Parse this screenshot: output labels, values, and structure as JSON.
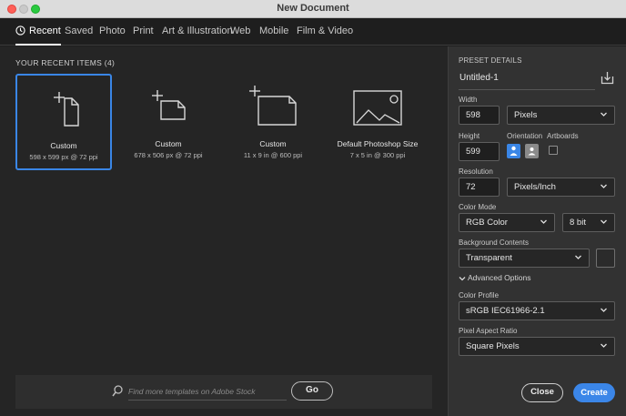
{
  "window": {
    "title": "New Document"
  },
  "tabs": [
    {
      "label": "Recent",
      "icon": "clock-icon"
    },
    {
      "label": "Saved"
    },
    {
      "label": "Photo"
    },
    {
      "label": "Print"
    },
    {
      "label": "Art & Illustration"
    },
    {
      "label": "Web"
    },
    {
      "label": "Mobile"
    },
    {
      "label": "Film & Video"
    }
  ],
  "recent": {
    "heading": "YOUR RECENT ITEMS  (4)",
    "items": [
      {
        "name": "Custom",
        "dims": "598 x 599 px @ 72 ppi",
        "icon": "custom-document-icon"
      },
      {
        "name": "Custom",
        "dims": "678 x 506 px @ 72 ppi",
        "icon": "custom-document-icon"
      },
      {
        "name": "Custom",
        "dims": "11 x 9 in @ 600 ppi",
        "icon": "custom-document-icon"
      },
      {
        "name": "Default Photoshop Size",
        "dims": "7 x 5 in @ 300 ppi",
        "icon": "image-icon"
      }
    ]
  },
  "search": {
    "placeholder": "Find more templates on Adobe Stock",
    "go_label": "Go"
  },
  "preset": {
    "heading": "PRESET DETAILS",
    "name": "Untitled-1",
    "width_label": "Width",
    "width_value": "598",
    "width_unit": "Pixels",
    "height_label": "Height",
    "height_value": "599",
    "orientation_label": "Orientation",
    "artboards_label": "Artboards",
    "resolution_label": "Resolution",
    "resolution_value": "72",
    "resolution_unit": "Pixels/Inch",
    "color_mode_label": "Color Mode",
    "color_mode_value": "RGB Color",
    "bit_depth_value": "8 bit",
    "background_label": "Background Contents",
    "background_value": "Transparent",
    "advanced_label": "Advanced Options",
    "color_profile_label": "Color Profile",
    "color_profile_value": "sRGB IEC61966-2.1",
    "pixel_aspect_label": "Pixel Aspect Ratio",
    "pixel_aspect_value": "Square Pixels"
  },
  "buttons": {
    "close": "Close",
    "create": "Create"
  },
  "colors": {
    "accent": "#3b86e8",
    "panel": "#323232",
    "main": "#252525"
  }
}
